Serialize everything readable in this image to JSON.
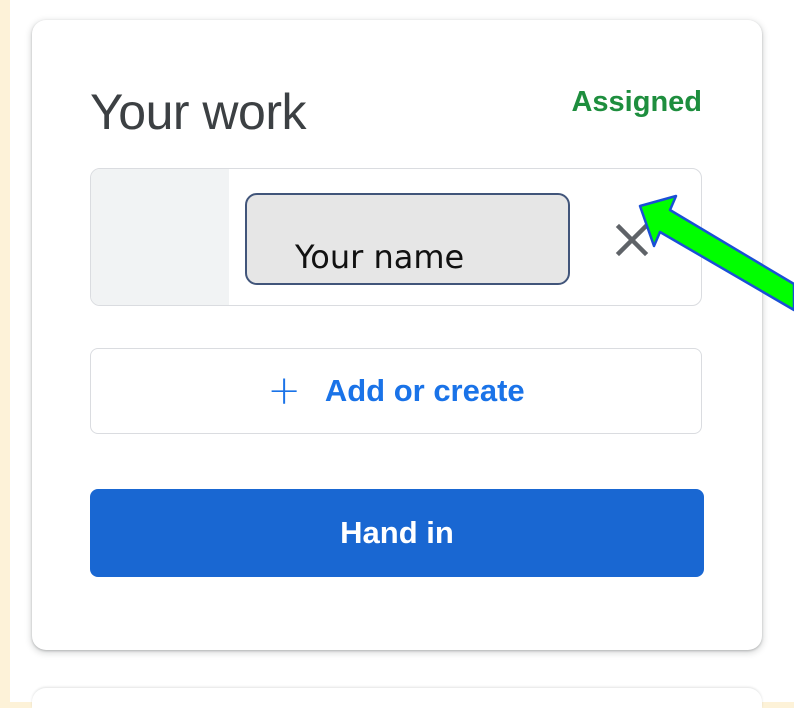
{
  "card": {
    "title": "Your work",
    "status": "Assigned"
  },
  "attachment": {
    "name": "Your name",
    "remove_icon": "close-icon"
  },
  "actions": {
    "add_icon": "plus-icon",
    "add_label": "Add or create",
    "hand_in_label": "Hand in"
  },
  "annotation": {
    "arrow_color": "#00ff00",
    "arrow_outline": "#1a4fd6"
  },
  "colors": {
    "status_green": "#1e8e3e",
    "accent_blue": "#1a73e8",
    "hand_in_blue": "#1967d2",
    "background": "#fdf2d8"
  }
}
